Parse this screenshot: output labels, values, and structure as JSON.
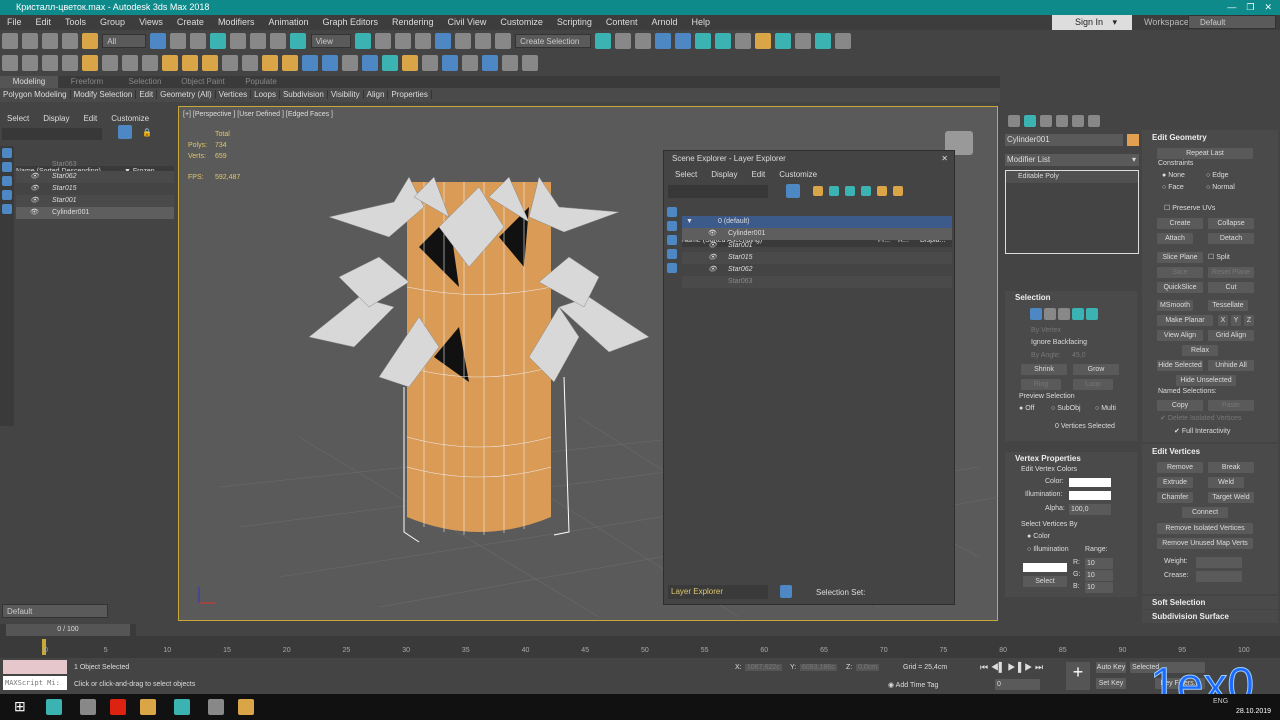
{
  "window": {
    "title": "Кристалл-цветок.max - Autodesk 3ds Max 2018"
  },
  "menu": [
    "File",
    "Edit",
    "Tools",
    "Group",
    "Views",
    "Create",
    "Modifiers",
    "Animation",
    "Graph Editors",
    "Rendering",
    "Civil View",
    "Customize",
    "Scripting",
    "Content",
    "Arnold",
    "Help"
  ],
  "account": {
    "sign_in": "Sign In",
    "workspaces_label": "Workspaces:",
    "workspace": "Default"
  },
  "toolbar": {
    "filter": "All",
    "ref_coord": "View",
    "selection_set": "Create Selection Se"
  },
  "ribbon_tabs": [
    "Modeling",
    "Freeform",
    "Selection",
    "Object Paint",
    "Populate"
  ],
  "ribbon_items": [
    "Polygon Modeling",
    "Modify Selection",
    "Edit",
    "Geometry (All)",
    "Vertices",
    "Loops",
    "Subdivision",
    "Visibility",
    "Align",
    "Properties"
  ],
  "left_explorer": {
    "menu": [
      "Select",
      "Display",
      "Edit",
      "Customize"
    ],
    "col_name": "Name (Sorted Descending)",
    "col_frozen": "Frozen",
    "items": [
      "Star063",
      "Star062",
      "Star015",
      "Star001",
      "Cylinder001"
    ],
    "layer": "Default"
  },
  "viewport": {
    "label": "[+] [Perspective ] [User Defined ] [Edged Faces ]",
    "total": "Total",
    "polys_label": "Polys:",
    "polys": "734",
    "verts_label": "Verts:",
    "verts": "659",
    "fps_label": "FPS:",
    "fps": "592,487"
  },
  "scene_explorer": {
    "title": "Scene Explorer - Layer Explorer",
    "menu": [
      "Select",
      "Display",
      "Edit",
      "Customize"
    ],
    "col_name": "Name (Sorted Ascending)",
    "col_fr": "Fr...",
    "col_r": "R...",
    "col_disp": "Displa...",
    "layer": "0 (default)",
    "items": [
      "Cylinder001",
      "Star001",
      "Star015",
      "Star062",
      "Star063"
    ],
    "footer_mode": "Layer Explorer",
    "selection_set": "Selection Set:"
  },
  "command_panel": {
    "object_name": "Cylinder001",
    "object_color": "#e0a050",
    "modifier_list": "Modifier List",
    "stack": [
      "Editable Poly"
    ],
    "edit_geometry": {
      "title": "Edit Geometry",
      "repeat_last": "Repeat Last",
      "constraints": "Constraints",
      "none": "None",
      "edge": "Edge",
      "face": "Face",
      "normal": "Normal",
      "preserve_uvs": "Preserve UVs",
      "create": "Create",
      "collapse": "Collapse",
      "attach": "Attach",
      "detach": "Detach",
      "slice_plane": "Slice Plane",
      "split": "Split",
      "slice": "Slice",
      "reset_plane": "Reset Plane",
      "quickslice": "QuickSlice",
      "cut": "Cut",
      "msmooth": "MSmooth",
      "tessellate": "Tessellate",
      "make_planar": "Make Planar",
      "x": "X",
      "y": "Y",
      "z": "Z",
      "view_align": "View Align",
      "grid_align": "Grid Align",
      "relax": "Relax",
      "hide_selected": "Hide Selected",
      "unhide_all": "Unhide All",
      "hide_unselected": "Hide Unselected",
      "named_selections": "Named Selections:",
      "copy": "Copy",
      "paste": "Paste",
      "delete_isolated": "Delete Isolated Vertices",
      "full_interactivity": "Full Interactivity"
    },
    "selection": {
      "title": "Selection",
      "by_vertex": "By Vertex",
      "ignore_backfacing": "Ignore Backfacing",
      "by_angle": "By Angle:",
      "angle": "45,0",
      "shrink": "Shrink",
      "grow": "Grow",
      "ring": "Ring",
      "loop": "Loop",
      "preview": "Preview Selection",
      "off": "Off",
      "subobj": "SubObj",
      "multi": "Multi",
      "status": "0 Vertices Selected"
    },
    "vertex_properties": {
      "title": "Vertex Properties",
      "edit_colors": "Edit Vertex Colors",
      "color": "Color:",
      "illumination": "Illumination:",
      "alpha_label": "Alpha:",
      "alpha": "100,0",
      "select_by": "Select Vertices By",
      "by_color": "Color",
      "by_illum": "Illumination",
      "range": "Range:",
      "r": "R:",
      "g": "G:",
      "b": "B:",
      "r_val": "10",
      "g_val": "10",
      "b_val": "10",
      "select": "Select"
    },
    "edit_vertices": {
      "title": "Edit Vertices",
      "remove": "Remove",
      "break": "Break",
      "extrude": "Extrude",
      "weld": "Weld",
      "chamfer": "Chamfer",
      "target_weld": "Target Weld",
      "connect": "Connect",
      "remove_isolated": "Remove Isolated Vertices",
      "remove_unused": "Remove Unused Map Verts",
      "weight": "Weight:",
      "crease": "Crease:"
    },
    "soft_selection": "Soft Selection",
    "subdivision_surface": "Subdivision Surface"
  },
  "timeline": {
    "frame": "0 / 100",
    "ticks": [
      "0",
      "5",
      "10",
      "15",
      "20",
      "25",
      "30",
      "35",
      "40",
      "45",
      "50",
      "55",
      "60",
      "65",
      "70",
      "75",
      "80",
      "85",
      "90",
      "95",
      "100"
    ]
  },
  "status": {
    "maxscript": "MAXScript Mi:",
    "selected": "1 Object Selected",
    "prompt": "Click or click-and-drag to select objects",
    "x_label": "X:",
    "x": "1067,622c",
    "y_label": "Y:",
    "y": "6093,186c",
    "z_label": "Z:",
    "z": "0,0cm",
    "grid": "Grid = 25,4cm",
    "add_time_tag": "Add Time Tag",
    "auto_key": "Auto Key",
    "set_key": "Set Key",
    "key_mode": "Selected",
    "key_filters": "Key Filters...",
    "frame": "0"
  },
  "taskbar": {
    "lang": "ENG",
    "date": "28.10.2019"
  },
  "watermark": "1ex0"
}
